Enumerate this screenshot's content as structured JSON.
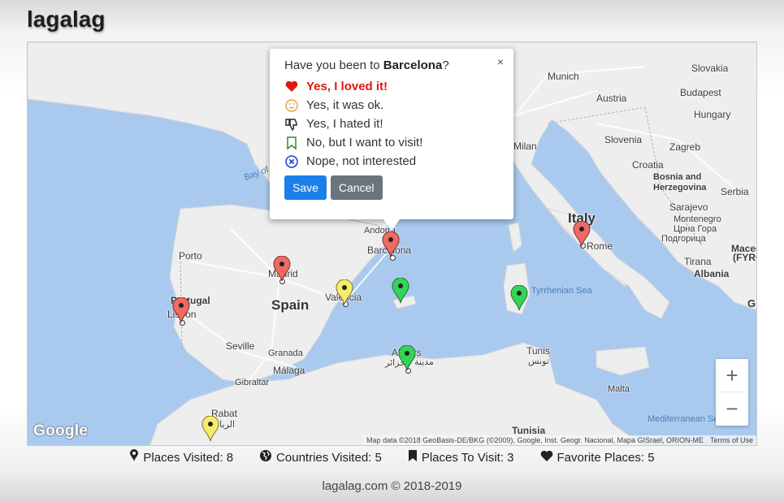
{
  "app": {
    "title": "lagalag"
  },
  "popup": {
    "question_prefix": "Have you been to",
    "place": "Barcelona",
    "question_suffix": "?",
    "close": "×",
    "options": [
      {
        "label": "Yes, I loved it!",
        "icon": "heart-icon",
        "color": "#e0190f",
        "selected": true
      },
      {
        "label": "Yes, it was ok.",
        "icon": "neutral-face-icon",
        "color": "#e8a24a"
      },
      {
        "label": "Yes, I hated it!",
        "icon": "thumbs-down-icon",
        "color": "#222222"
      },
      {
        "label": "No, but I want to visit!",
        "icon": "bookmark-icon",
        "color": "#2e8b2e"
      },
      {
        "label": "Nope, not interested",
        "icon": "x-circle-icon",
        "color": "#1a3fd6"
      }
    ],
    "save": "Save",
    "cancel": "Cancel"
  },
  "map": {
    "labels": {
      "munich": "Munich",
      "slovakia": "Slovakia",
      "austria": "Austria",
      "budapest": "Budapest",
      "hungary": "Hungary",
      "slovenia": "Slovenia",
      "zagreb": "Zagreb",
      "milan": "Milan",
      "croatia": "Croatia",
      "bosnia": "Bosnia and Herzegovina",
      "serbia": "Serbia",
      "sarajevo": "Sarajevo",
      "montenegro": "Montenegro",
      "montenegro_cyr": "Црна Гора",
      "podgorica": "Podgorica",
      "podgorica_cyr": "Подгорица",
      "italy": "Italy",
      "rome": "Rome",
      "maced": "Maced",
      "fyrc": "(FYRC",
      "tirana": "Tirana",
      "albania": "Albania",
      "andorra": "Andorra",
      "barcelona": "Barcelona",
      "porto": "Porto",
      "madrid": "Madrid",
      "spain": "Spain",
      "valencia": "Valencia",
      "portugal": "Portugal",
      "lisbon": "Lisbon",
      "seville": "Seville",
      "granada": "Granada",
      "malaga": "Málaga",
      "gibraltar": "Gibraltar",
      "rabat": "Rabat",
      "rabat_ar": "الرباط",
      "algiers": "Algiers",
      "algiers_ar": "الجزائر",
      "algiers_ar2": "مدينة",
      "tunis": "Tunis",
      "tunis_ar": "تونس",
      "tunisia": "Tunisia",
      "malta": "Malta",
      "tyrrhenian": "Tyrrhenian Sea",
      "mediterranean": "Mediterranean Se",
      "bay": "Bay of",
      "g": "G"
    },
    "google": "Google",
    "attribution": "Map data ©2018 GeoBasis-DE/BKG (©2009), Google, Inst. Geogr. Nacional, Mapa GISrael, ORION-ME",
    "terms": "Terms of Use",
    "zoom_in": "+",
    "zoom_out": "−",
    "pin_colors": {
      "loved": "#ee6b63",
      "ok": "#f7ec6a",
      "want": "#34d456"
    }
  },
  "stats": {
    "places_visited": "Places Visited: 8",
    "countries_visited": "Countries Visited: 5",
    "places_to_visit": "Places To Visit: 3",
    "favorite_places": "Favorite Places: 5"
  },
  "footer": "lagalag.com © 2018-2019"
}
